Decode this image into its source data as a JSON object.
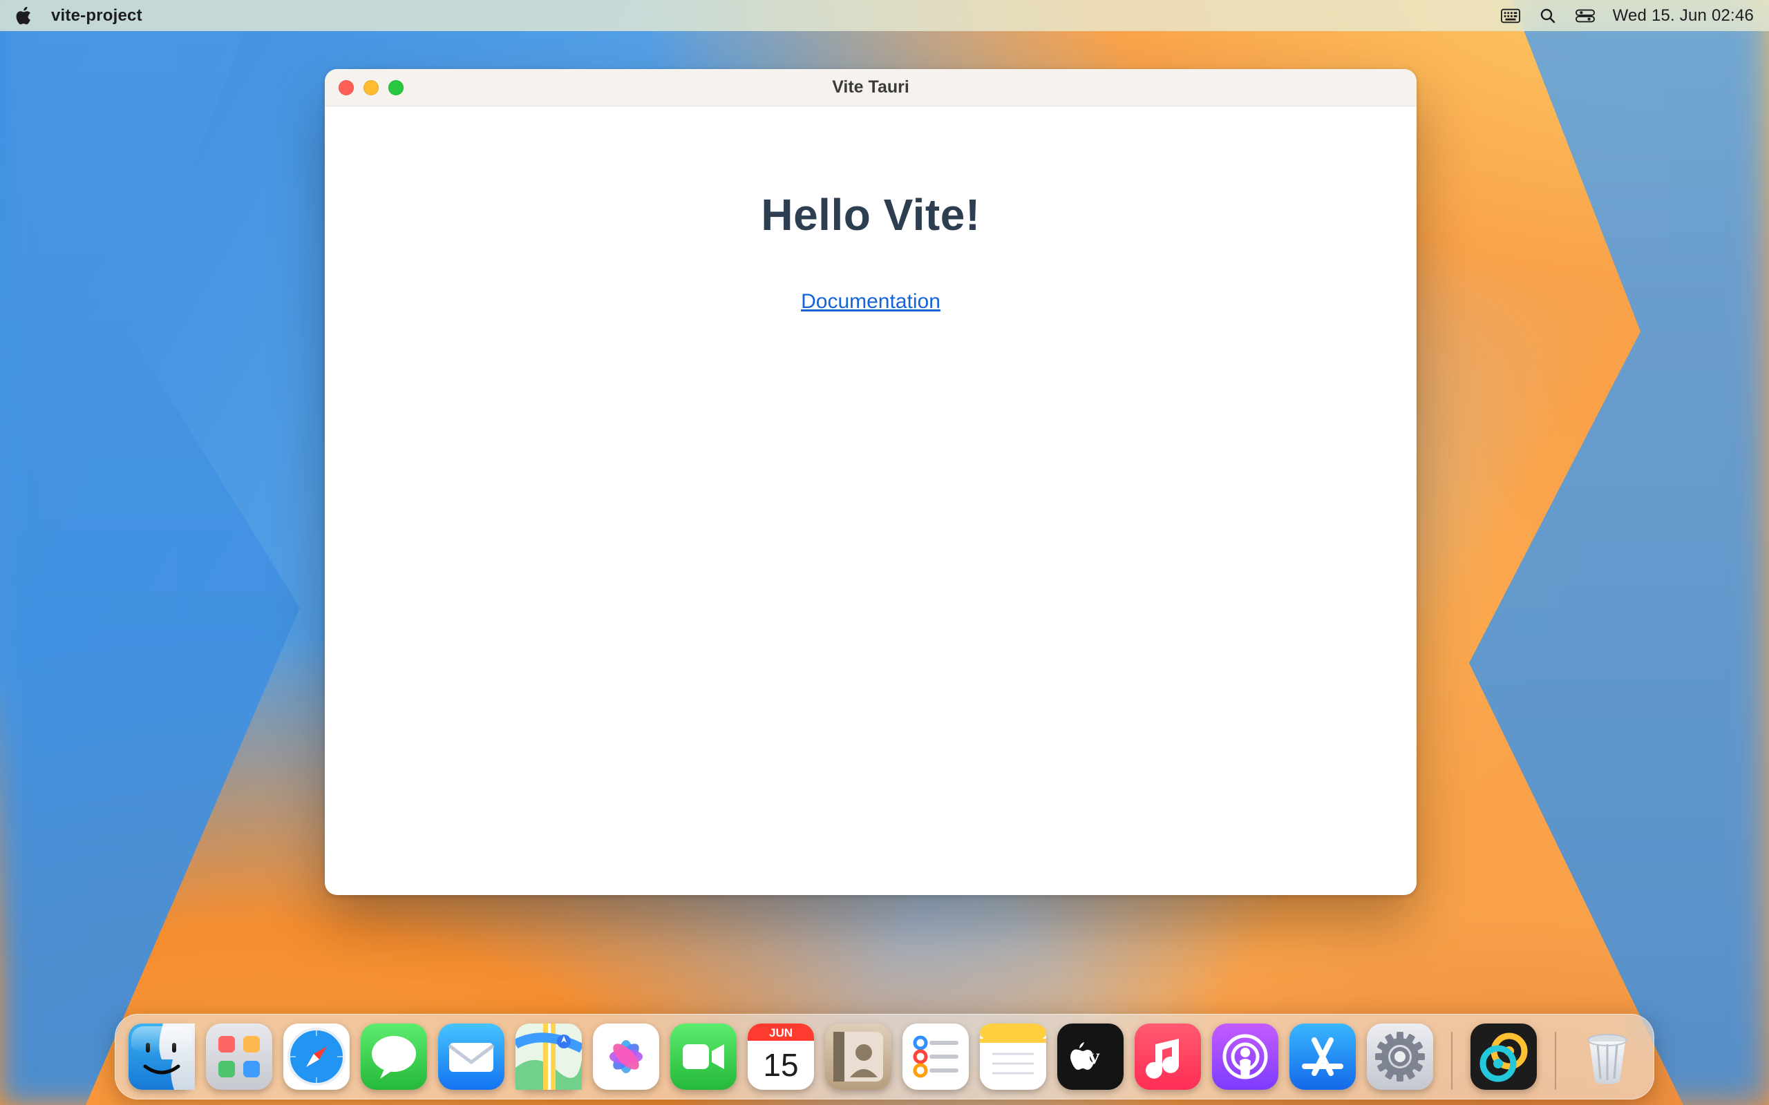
{
  "menubar": {
    "app_name": "vite-project",
    "datetime": "Wed 15. Jun  02:46"
  },
  "window": {
    "title": "Vite Tauri",
    "heading": "Hello Vite!",
    "link_label": "Documentation"
  },
  "dock": {
    "items": [
      {
        "name": "finder"
      },
      {
        "name": "launchpad"
      },
      {
        "name": "safari"
      },
      {
        "name": "messages"
      },
      {
        "name": "mail"
      },
      {
        "name": "maps"
      },
      {
        "name": "photos"
      },
      {
        "name": "facetime"
      },
      {
        "name": "calendar",
        "month": "JUN",
        "day": "15"
      },
      {
        "name": "contacts"
      },
      {
        "name": "reminders"
      },
      {
        "name": "notes"
      },
      {
        "name": "appletv"
      },
      {
        "name": "music"
      },
      {
        "name": "podcasts"
      },
      {
        "name": "appstore"
      },
      {
        "name": "system-settings"
      }
    ],
    "extras": [
      {
        "name": "tauri"
      }
    ],
    "trash": {
      "name": "trash"
    }
  }
}
